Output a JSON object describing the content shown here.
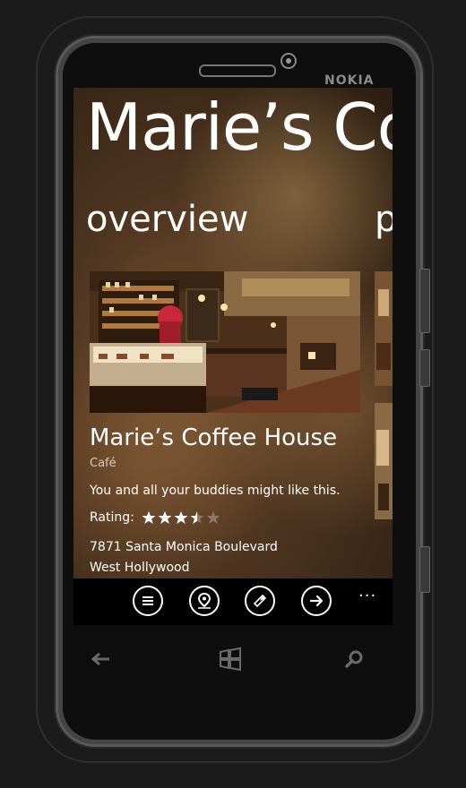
{
  "device": {
    "brand": "NOKIA"
  },
  "app": {
    "title": "Marie’s Coffee House"
  },
  "pivot": {
    "active": "overview",
    "next": "p"
  },
  "place": {
    "name": "Marie’s Coffee House",
    "category": "Café",
    "tagline": "You and all your buddies might like this.",
    "rating_label": "Rating:",
    "rating": 3.5,
    "rating_max": 5,
    "address_line1": "7871 Santa Monica Boulevard",
    "address_line2": "West Hollywood"
  },
  "appbar": {
    "buttons": [
      "list-icon",
      "map-pin-icon",
      "compass-icon",
      "arrow-right-icon"
    ],
    "more": "..."
  },
  "hardware_keys": [
    "back-icon",
    "windows-icon",
    "search-icon"
  ],
  "colors": {
    "star_filled": "#ffffff",
    "star_empty": "#8a7a66",
    "appbar": "#000000"
  }
}
